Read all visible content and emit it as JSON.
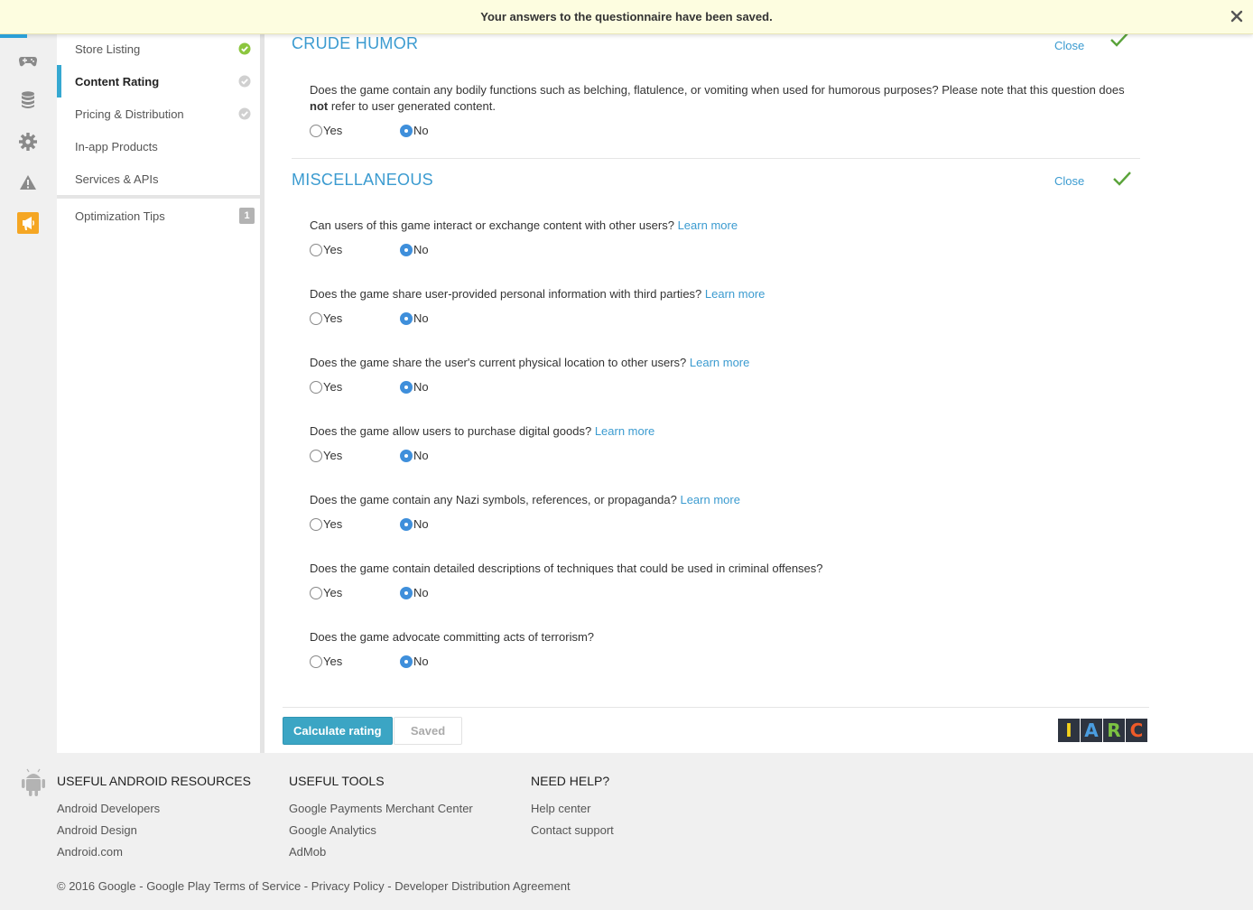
{
  "notice": {
    "text": "Your answers to the questionnaire have been saved."
  },
  "rail": {
    "icons": [
      "gamepad-icon",
      "database-icon",
      "gear-icon",
      "warning-icon",
      "megaphone-icon"
    ]
  },
  "sidenav": {
    "items": [
      {
        "label": "Store Listing",
        "status": "complete"
      },
      {
        "label": "Content Rating",
        "status": "incomplete",
        "active": true
      },
      {
        "label": "Pricing & Distribution",
        "status": "incomplete"
      },
      {
        "label": "In-app Products"
      },
      {
        "label": "Services & APIs"
      }
    ],
    "optimization": {
      "label": "Optimization Tips",
      "count": "1"
    }
  },
  "sections": {
    "crude": {
      "heading": "CRUDE HUMOR",
      "close": "Close",
      "question_pre": "Does the game contain any bodily functions such as belching, flatulence, or vomiting when used for humorous purposes? Please note that this question does ",
      "question_bold": "not",
      "question_post": " refer to user generated content.",
      "answer": "No"
    },
    "misc": {
      "heading": "MISCELLANEOUS",
      "close": "Close",
      "questions": [
        {
          "text": "Can users of this game interact or exchange content with other users?",
          "learn_more": "Learn more",
          "answer": "No"
        },
        {
          "text": "Does the game share user-provided personal information with third parties?",
          "learn_more": "Learn more",
          "answer": "No"
        },
        {
          "text": "Does the game share the user's current physical location to other users?",
          "learn_more": "Learn more",
          "answer": "No"
        },
        {
          "text": "Does the game allow users to purchase digital goods?",
          "learn_more": "Learn more",
          "answer": "No"
        },
        {
          "text": "Does the game contain any Nazi symbols, references, or propaganda?",
          "learn_more": "Learn more",
          "answer": "No"
        },
        {
          "text": "Does the game contain detailed descriptions of techniques that could be used in criminal offenses?",
          "answer": "No"
        },
        {
          "text": "Does the game advocate committing acts of terrorism?",
          "answer": "No"
        }
      ]
    }
  },
  "radio_labels": {
    "yes": "Yes",
    "no": "No"
  },
  "actions": {
    "calculate": "Calculate rating",
    "saved": "Saved"
  },
  "iarc": {
    "letters": [
      "I",
      "A",
      "R",
      "C"
    ],
    "colors": [
      "#f5d21c",
      "#4a9de0",
      "#7cc242",
      "#ef5a28"
    ]
  },
  "footer": {
    "columns": [
      {
        "heading": "USEFUL ANDROID RESOURCES",
        "links": [
          "Android Developers",
          "Android Design",
          "Android.com"
        ]
      },
      {
        "heading": "USEFUL TOOLS",
        "links": [
          "Google Payments Merchant Center",
          "Google Analytics",
          "AdMob"
        ]
      },
      {
        "heading": "NEED HELP?",
        "links": [
          "Help center",
          "Contact support"
        ]
      }
    ],
    "copyright": "© 2016 Google - Google Play Terms of Service - Privacy Policy - Developer Distribution Agreement"
  },
  "colors": {
    "accent": "#3b9bd0",
    "check_green": "#8cc63e",
    "button": "#3ba5c4"
  }
}
